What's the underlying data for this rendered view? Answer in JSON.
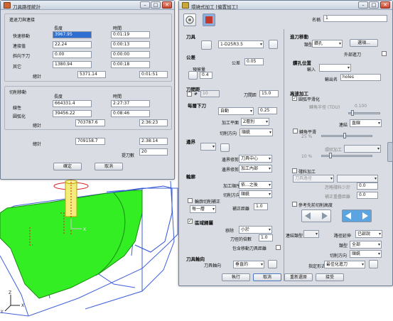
{
  "left_window": {
    "title": "刀具路徑統計",
    "section1": {
      "label": "進退刀與連接",
      "col_length": "長度",
      "col_time": "時間",
      "rows": [
        {
          "label": "快速移動",
          "length": "3967.95",
          "time": "0:01:19"
        },
        {
          "label": "連接值",
          "length": "22.24",
          "time": "0:00:13"
        },
        {
          "label": "斜向下刀",
          "length": "0.00",
          "time": "0:00:00"
        },
        {
          "label": "其它",
          "length": "1380.94",
          "time": "0:00:18"
        }
      ],
      "total_label": "總計",
      "total_length": "5371.14",
      "total_time": "0:01:51"
    },
    "section2": {
      "label": "切削移動",
      "col_length": "長度",
      "col_time": "時間",
      "rows": [
        {
          "label": "線性",
          "length": "664331.4",
          "time": "2:27:37"
        },
        {
          "label": "圓弧化",
          "length": "39456.22",
          "time": "0:08:46"
        }
      ],
      "total_label": "總計",
      "total_length": "703787.6",
      "total_time": "2:36:23"
    },
    "grand_label": "總計",
    "grand_length": "709158.7",
    "grand_time": "2:38:14",
    "tool_count_label": "提刀數",
    "tool_count": "20",
    "ok": "確定",
    "cancel": "取消"
  },
  "right_window": {
    "title": "環繞式加工 [偏置加工]",
    "name_label": "名稱",
    "name_value": "1",
    "tool": {
      "label": "刀具",
      "value": "1-D25R3.5"
    },
    "tolerance": {
      "label": "公差",
      "tol_label": "公差",
      "tol_value": "0.05",
      "allowance_label": "預留量",
      "allowance_value": "0.4"
    },
    "stepover": {
      "label": "刀間距",
      "hash": "#",
      "count": "10",
      "dist_label": "刀間距",
      "dist_value": "15.0"
    },
    "stepdown": {
      "label": "每層下刀",
      "mode": "自動",
      "mode_value": "0.25",
      "order_label": "加工平面",
      "order_value": "Z層別",
      "dir_label": "切削方向",
      "dir_value": "順銑"
    },
    "boundary": {
      "label": "邊界",
      "prim_label": "邊界修剪",
      "prim_value": "刀具中心",
      "sec_label": "邊界修剪",
      "sec_value": "加工內部"
    },
    "contour": {
      "label": "輪廓",
      "order_label": "加工順序",
      "order_value": "依...之後",
      "dir_label": "切削方向",
      "dir_value": "順銑",
      "chk_label": "輪廓切削補正",
      "extra_label": "補正距離",
      "extra_value": "1.0",
      "each_value": "每一層"
    },
    "region": {
      "label": "區域歸屬",
      "remove_label": "移除",
      "remove_value": "小於",
      "tool_dia_label": "刀徑的倍數",
      "tool_dia_value": "1.0",
      "incl_label": "包含移動刀具距離"
    },
    "direction": {
      "label": "刀具軸向",
      "axis_label": "刀具軸向",
      "axis_value": "垂直的"
    },
    "plunge": {
      "label": "進刀移動",
      "type_label": "類型",
      "type_value": "鑽孔",
      "select_label": "選項...",
      "outside_label": "外部進刀"
    },
    "drill": {
      "label": "鑽孔位置",
      "input_label": "輸入",
      "out_label": "輸出名",
      "out_value": "holes"
    },
    "hsm": {
      "label": "高速加工",
      "corner_label": "圓弧平滑化",
      "radius_label": "轉角半徑 (TDU)",
      "radius_value": "0.100",
      "conn_label": "連結",
      "conn_value": "直線",
      "smooth_label": "轉角平滑",
      "smooth_pct": "25 %",
      "loop_label": "環狀加工",
      "loop_pct": "10 %"
    },
    "rest": {
      "label": "殘料加工",
      "type_value": "刀具路徑",
      "minlen_label": "忽略殘料少於",
      "minlen_value": "0.0",
      "comp_label": "補正重疊距離",
      "comp_value": "0.0",
      "ref_label": "參考先前切削高度"
    },
    "link": {
      "type_label": "連結類型",
      "path_label": "路徑延伸",
      "path_value": "已啟說",
      "kind_label": "類型",
      "kind_value": "全部",
      "cut_label": "切削方向",
      "cut_value": "順銑",
      "spec_label": "指定形式",
      "spec_value": "最佳化進刀"
    },
    "footer": {
      "run": "執行",
      "cancel": "取消",
      "reset": "重新還原",
      "accept": "接受"
    }
  },
  "colors": {
    "green": "#33ee22",
    "accent": "#2f6fd1",
    "window_bg": "#d9dde3"
  }
}
